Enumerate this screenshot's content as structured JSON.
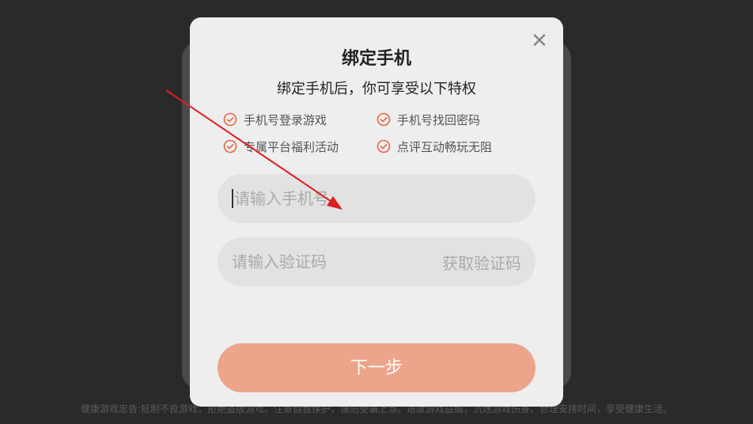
{
  "footer": {
    "notice": "健康游戏忠告:抵制不良游戏，拒绝盗版游戏。注意自我保护，谨防受骗上当。适度游戏益脑，沉迷游戏伤身。合理安排时间，享受健康生活。"
  },
  "modal": {
    "title": "绑定手机",
    "subtitle": "绑定手机后，你可享受以下特权",
    "close_icon": "close-icon",
    "perks": [
      {
        "label": "手机号登录游戏",
        "icon": "check-circle-icon"
      },
      {
        "label": "手机号找回密码",
        "icon": "check-circle-icon"
      },
      {
        "label": "专属平台福利活动",
        "icon": "check-circle-icon"
      },
      {
        "label": "点评互动畅玩无阻",
        "icon": "check-circle-icon"
      }
    ],
    "phone_input": {
      "placeholder": "请输入手机号",
      "value": ""
    },
    "code_input": {
      "placeholder": "请输入验证码",
      "value": ""
    },
    "get_code_label": "获取验证码",
    "next_label": "下一步"
  },
  "colors": {
    "accent": "#e8663c",
    "button": "#eca48a",
    "annotation_arrow": "#e01e1e"
  }
}
